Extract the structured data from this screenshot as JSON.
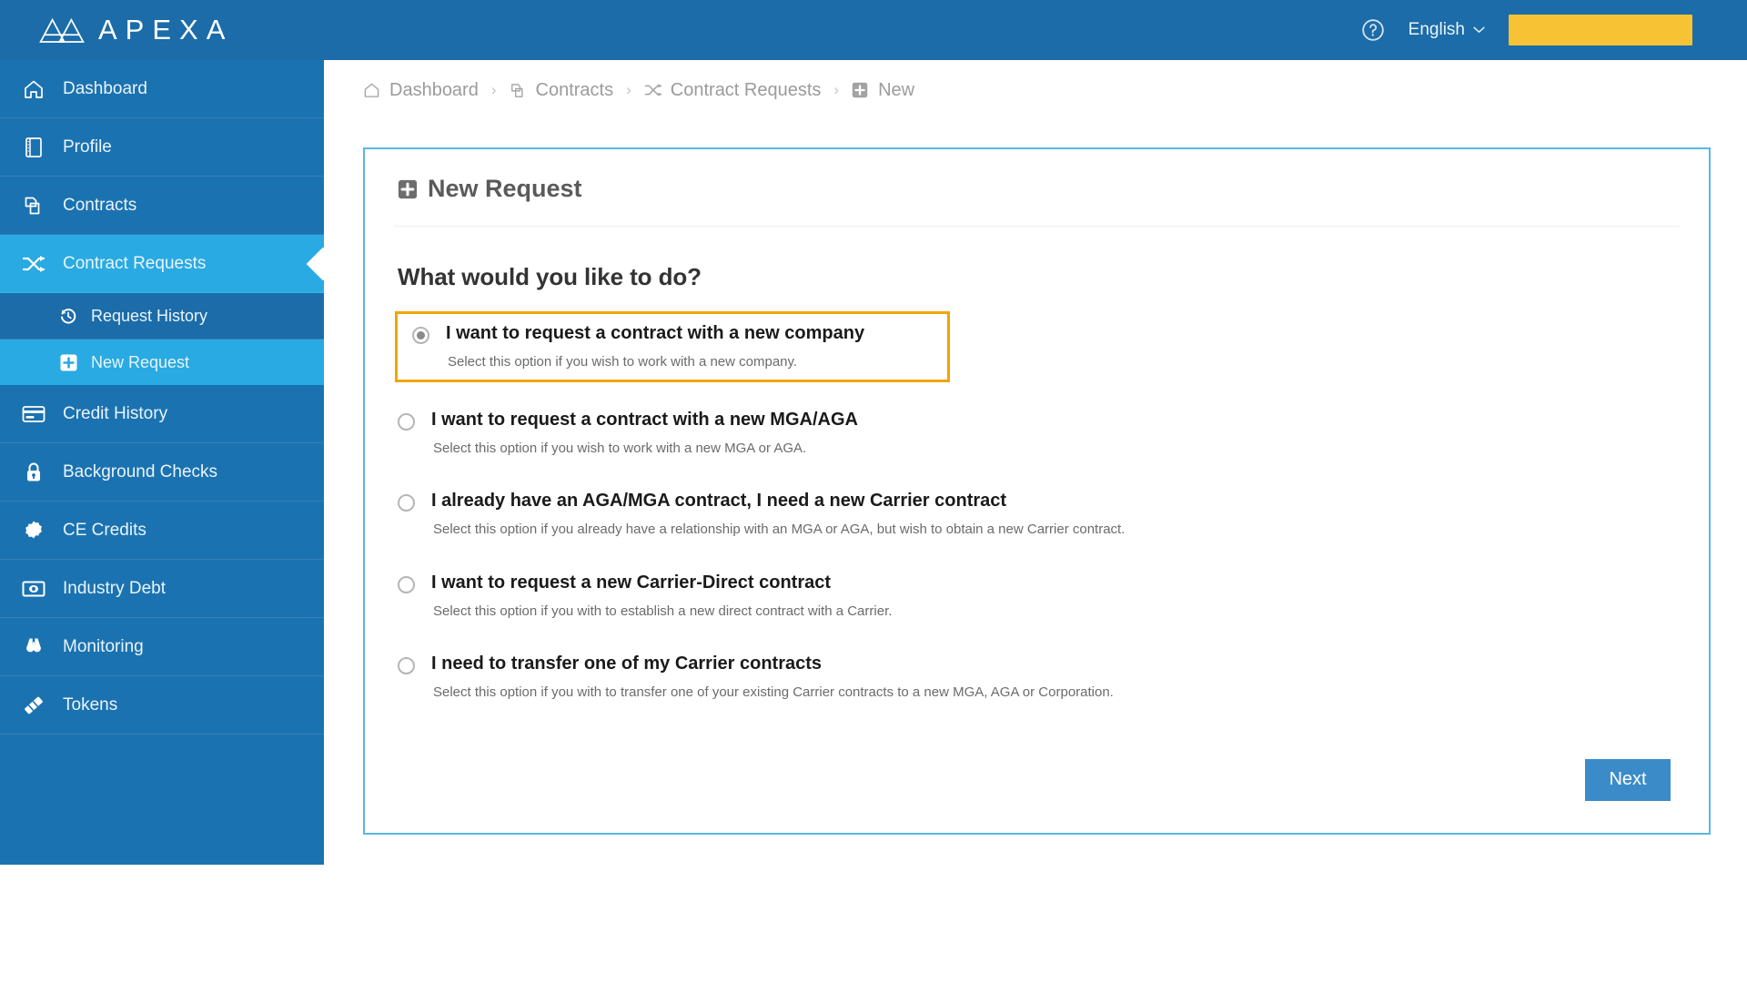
{
  "topbar": {
    "brand_name": "APEXA",
    "brand_icon": "apexa-triangles-logo",
    "help_icon": "help-circle-icon",
    "language_label": "English",
    "language_chevron_icon": "chevron-down-icon",
    "user_chip_color": "#f7c334"
  },
  "sidebar": {
    "bg_color": "#1b72b0",
    "active_color": "#29aae2",
    "items": [
      {
        "label": "Dashboard",
        "icon": "home-icon",
        "active": false
      },
      {
        "label": "Profile",
        "icon": "book-icon",
        "active": false
      },
      {
        "label": "Contracts",
        "icon": "copy-files-icon",
        "active": false
      },
      {
        "label": "Contract Requests",
        "icon": "shuffle-icon",
        "active": true
      },
      {
        "label": "Credit History",
        "icon": "credit-card-icon",
        "active": false
      },
      {
        "label": "Background Checks",
        "icon": "lock-icon",
        "active": false
      },
      {
        "label": "CE Credits",
        "icon": "badge-icon",
        "active": false
      },
      {
        "label": "Industry Debt",
        "icon": "money-icon",
        "active": false
      },
      {
        "label": "Monitoring",
        "icon": "binoculars-icon",
        "active": false
      },
      {
        "label": "Tokens",
        "icon": "ticket-icon",
        "active": false
      }
    ],
    "subitems": [
      {
        "label": "Request History",
        "icon": "history-icon",
        "selected": false
      },
      {
        "label": "New Request",
        "icon": "plus-box-icon",
        "selected": true
      }
    ]
  },
  "breadcrumb": {
    "separator": "›",
    "items": [
      {
        "label": "Dashboard",
        "icon": "home-icon"
      },
      {
        "label": "Contracts",
        "icon": "copy-files-icon"
      },
      {
        "label": "Contract Requests",
        "icon": "shuffle-icon"
      },
      {
        "label": "New",
        "icon": "plus-box-icon"
      }
    ]
  },
  "panel": {
    "border_color": "#5ab6e5",
    "title": "New Request",
    "title_icon": "plus-box-icon",
    "question": "What would you like to do?",
    "highlight_color": "#f0a500",
    "options": [
      {
        "label": "I want to request a contract with a new company",
        "description": "Select this option if you wish to work with a new company.",
        "checked": true,
        "highlighted": true
      },
      {
        "label": "I want to request a contract with a new MGA/AGA",
        "description": "Select this option if you wish to work with a new MGA or AGA.",
        "checked": false,
        "highlighted": false
      },
      {
        "label": "I already have an AGA/MGA contract, I need a new Carrier contract",
        "description": "Select this option if you already have a relationship with an MGA or AGA, but wish to obtain a new Carrier contract.",
        "checked": false,
        "highlighted": false
      },
      {
        "label": "I want to request a new Carrier-Direct contract",
        "description": "Select this option if you with to establish a new direct contract with a Carrier.",
        "checked": false,
        "highlighted": false
      },
      {
        "label": "I need to transfer one of my Carrier contracts",
        "description": "Select this option if you with to transfer one of your existing Carrier contracts to a new MGA, AGA or Corporation.",
        "checked": false,
        "highlighted": false
      }
    ],
    "next_label": "Next",
    "next_color": "#3b8bc9"
  }
}
